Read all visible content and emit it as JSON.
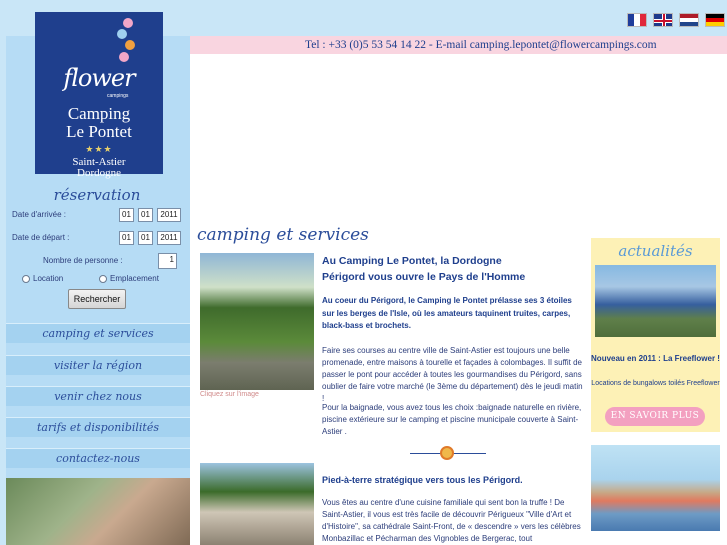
{
  "languages": [
    "Français",
    "English",
    "Nederlands",
    "Deutsch"
  ],
  "logo": {
    "brand": "flower",
    "tagline": "campings",
    "title_line1": "Camping",
    "title_line2": "Le Pontet",
    "stars": "★★★",
    "sub_line1": "Saint-Astier",
    "sub_line2": "Dordogne"
  },
  "contact": {
    "text": "Tel : +33 (0)5 53 54 14 22 - E-mail camping.lepontet@flowercampings.com"
  },
  "reservation": {
    "title": "réservation",
    "arrival_label": "Date d'arrivée :",
    "departure_label": "Date de départ :",
    "arrival": {
      "day": "01",
      "month": "01",
      "year": "2011"
    },
    "departure": {
      "day": "01",
      "month": "01",
      "year": "2011"
    },
    "persons_label": "Nombre de personne :",
    "persons_value": "1",
    "option_location": "Location",
    "option_emplacement": "Emplacement",
    "search_button": "Rechercher"
  },
  "nav": [
    "camping et services",
    "visiter la région",
    "venir chez nous",
    "tarifs et disponibilités",
    "contactez-nous"
  ],
  "main": {
    "section_title": "camping et services",
    "photo_caption": "Cliquez sur l'image",
    "heading_line1": "Au Camping Le Pontet, la Dordogne",
    "heading_line2": "Périgord vous ouvre le Pays de l'Homme",
    "intro": "Au coeur du Périgord, le Camping le Pontet prélasse ses 3 étoiles sur les berges de l'Isle, où les amateurs taquinent truites, carpes, black-bass et brochets.",
    "body1": "Faire ses courses au centre ville de Saint-Astier est toujours une belle promenade, entre maisons à tourelle et façades à colombages. Il suffit de passer le pont pour accéder à toutes les gourmandises du Périgord, sans oublier de faire votre marché (le 3ème du département) dès le jeudi matin !",
    "body2": "Pour la baignade, vous avez tous les choix :baignade naturelle en rivière, piscine extérieure sur le camping et piscine municipale couverte à  Saint-Astier .",
    "heading2": "Pied-à-terre stratégique vers tous les Périgord.",
    "body3": "Vous êtes au centre d'une cuisine familiale qui sent bon la truffe ! De Saint-Astier, il vous est très facile de découvrir Périgueux \"Ville d'Art et d'Histoire\", sa cathédrale Saint-Front, de « descendre » vers les célèbres Monbazillac et Pécharman des Vignobles de Bergerac, tout"
  },
  "news": {
    "title": "actualités",
    "heading": "Nouveau en 2011 : La Freeflower !",
    "text": "Locations de bungalows toilés Freeflower",
    "button": "EN SAVOIR PLUS"
  }
}
